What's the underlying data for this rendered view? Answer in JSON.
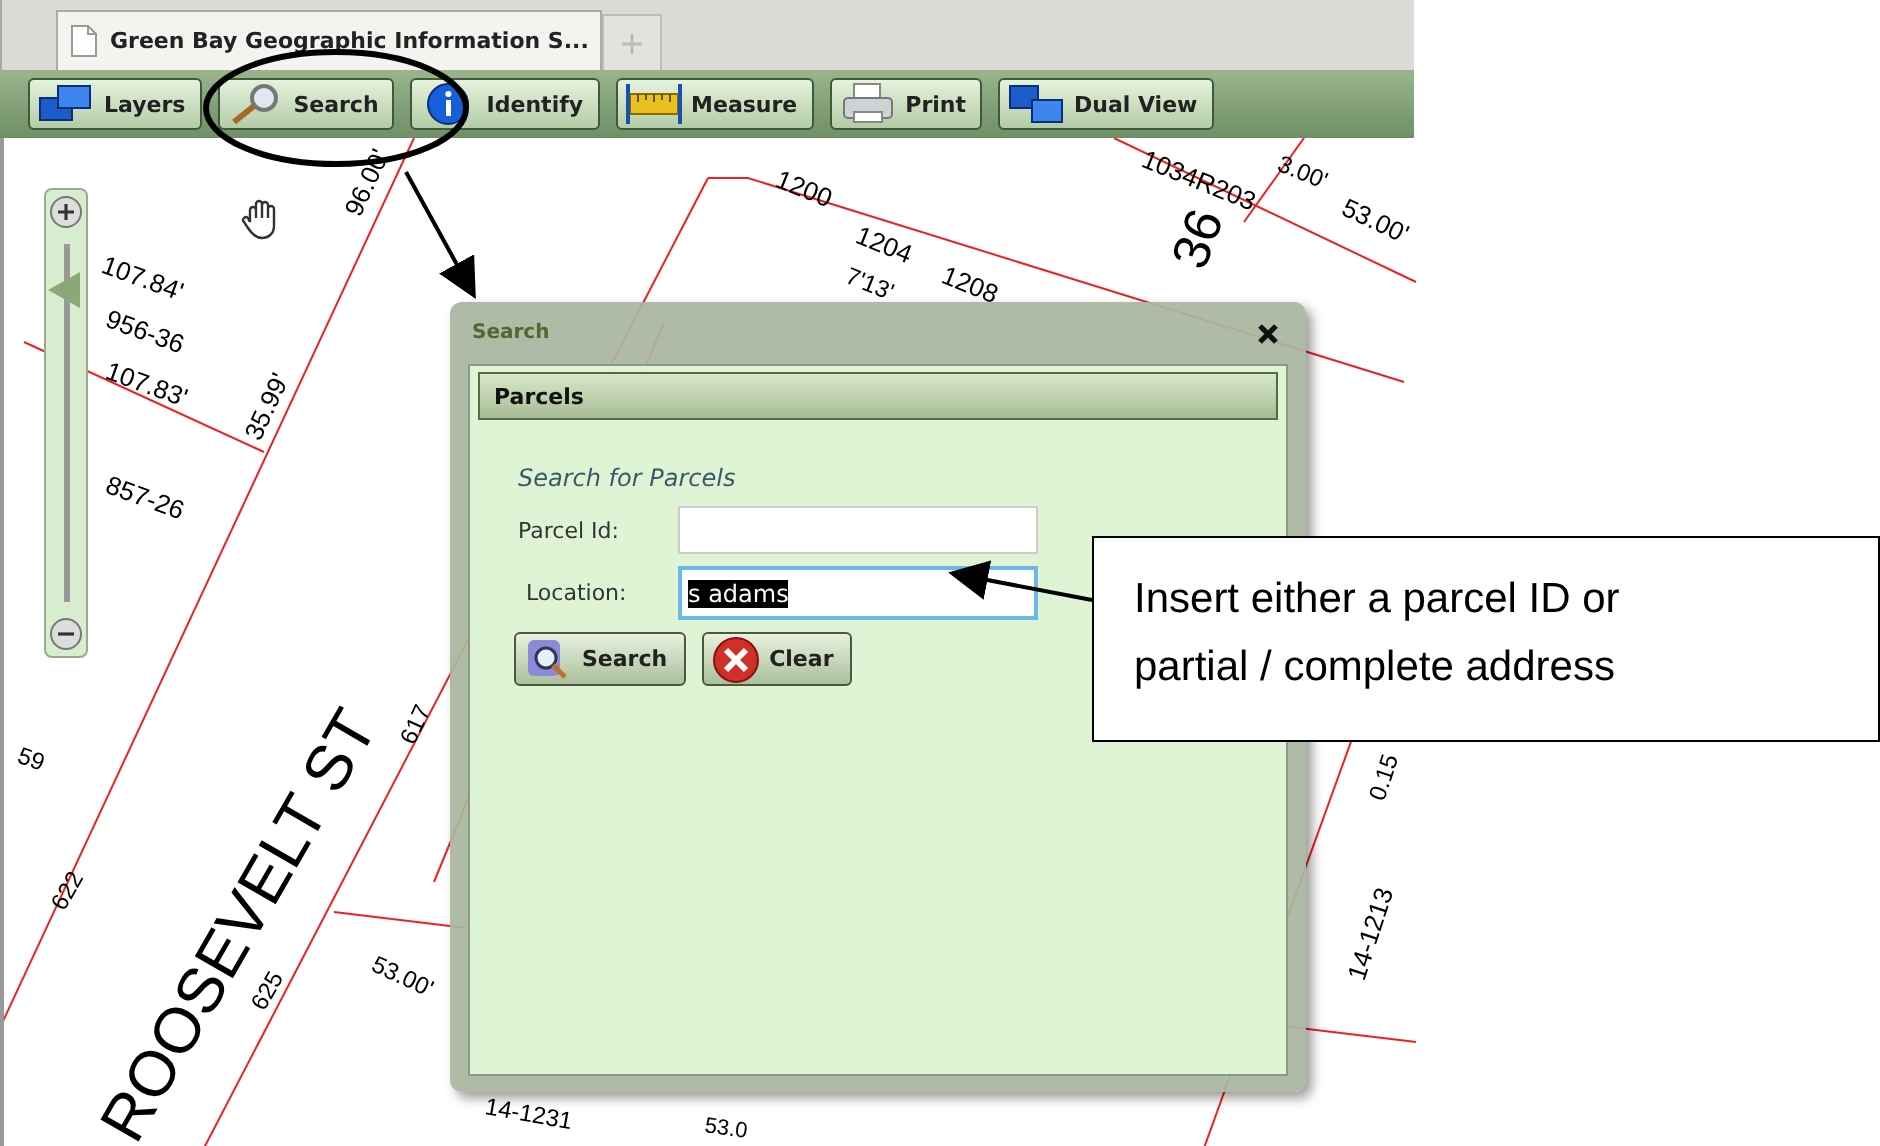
{
  "browser_tab": {
    "title": "Green Bay Geographic Information S..."
  },
  "toolbar": [
    {
      "label": "Layers",
      "kind": "layers"
    },
    {
      "label": "Search",
      "kind": "search"
    },
    {
      "label": "Identify",
      "kind": "identify"
    },
    {
      "label": "Measure",
      "kind": "measure"
    },
    {
      "label": "Print",
      "kind": "print"
    },
    {
      "label": "Dual View",
      "kind": "dual"
    }
  ],
  "map": {
    "zoom": {
      "level": 0.87
    },
    "labels": [
      "1200",
      "1204",
      "1208",
      "7'13'",
      "1034R203",
      "3.00'",
      "36",
      "53.00'",
      "96.00'",
      "107.84'",
      "956-36",
      "107.83'",
      "35.99'",
      "857-26",
      "ROOSEVELT ST",
      "617",
      "622",
      "625",
      "53.00'",
      "59",
      "14-1213",
      "0.15",
      "14-1231",
      "53.0"
    ]
  },
  "dialog": {
    "title": "Search",
    "panel_title": "Parcels",
    "heading": "Search for Parcels",
    "fields": [
      {
        "label": "Parcel Id:",
        "highlighted": false
      },
      {
        "label": "Location:",
        "value": "s adams",
        "highlighted": true
      }
    ],
    "buttons": [
      {
        "label": "Search",
        "kind": "search"
      },
      {
        "label": "Clear",
        "kind": "clear"
      }
    ]
  },
  "callout": {
    "text": "Insert either a parcel ID or partial / complete address"
  }
}
